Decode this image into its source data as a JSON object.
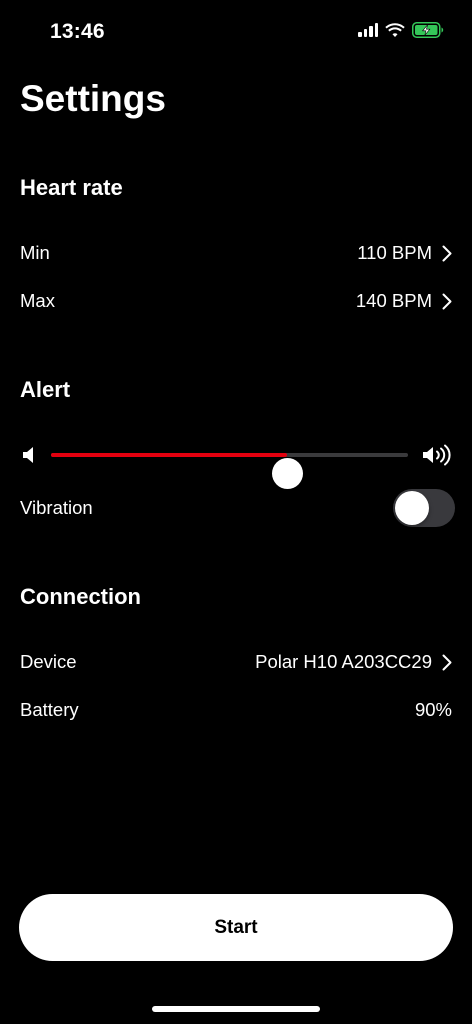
{
  "status_bar": {
    "time": "13:46",
    "signal_icon": "cellular-signal-icon",
    "wifi_icon": "wifi-icon",
    "battery_icon": "battery-charging-icon",
    "battery_color": "#34c759"
  },
  "title": "Settings",
  "heart_rate": {
    "title": "Heart rate",
    "min_label": "Min",
    "min_value": "110 BPM",
    "max_label": "Max",
    "max_value": "140 BPM"
  },
  "alert": {
    "title": "Alert",
    "volume_level": 0.66,
    "volume_fill_color": "#e3000f",
    "vibration_label": "Vibration",
    "vibration_on": false
  },
  "connection": {
    "title": "Connection",
    "device_label": "Device",
    "device_value": "Polar H10 A203CC29",
    "battery_label": "Battery",
    "battery_value": "90%"
  },
  "start_label": "Start"
}
